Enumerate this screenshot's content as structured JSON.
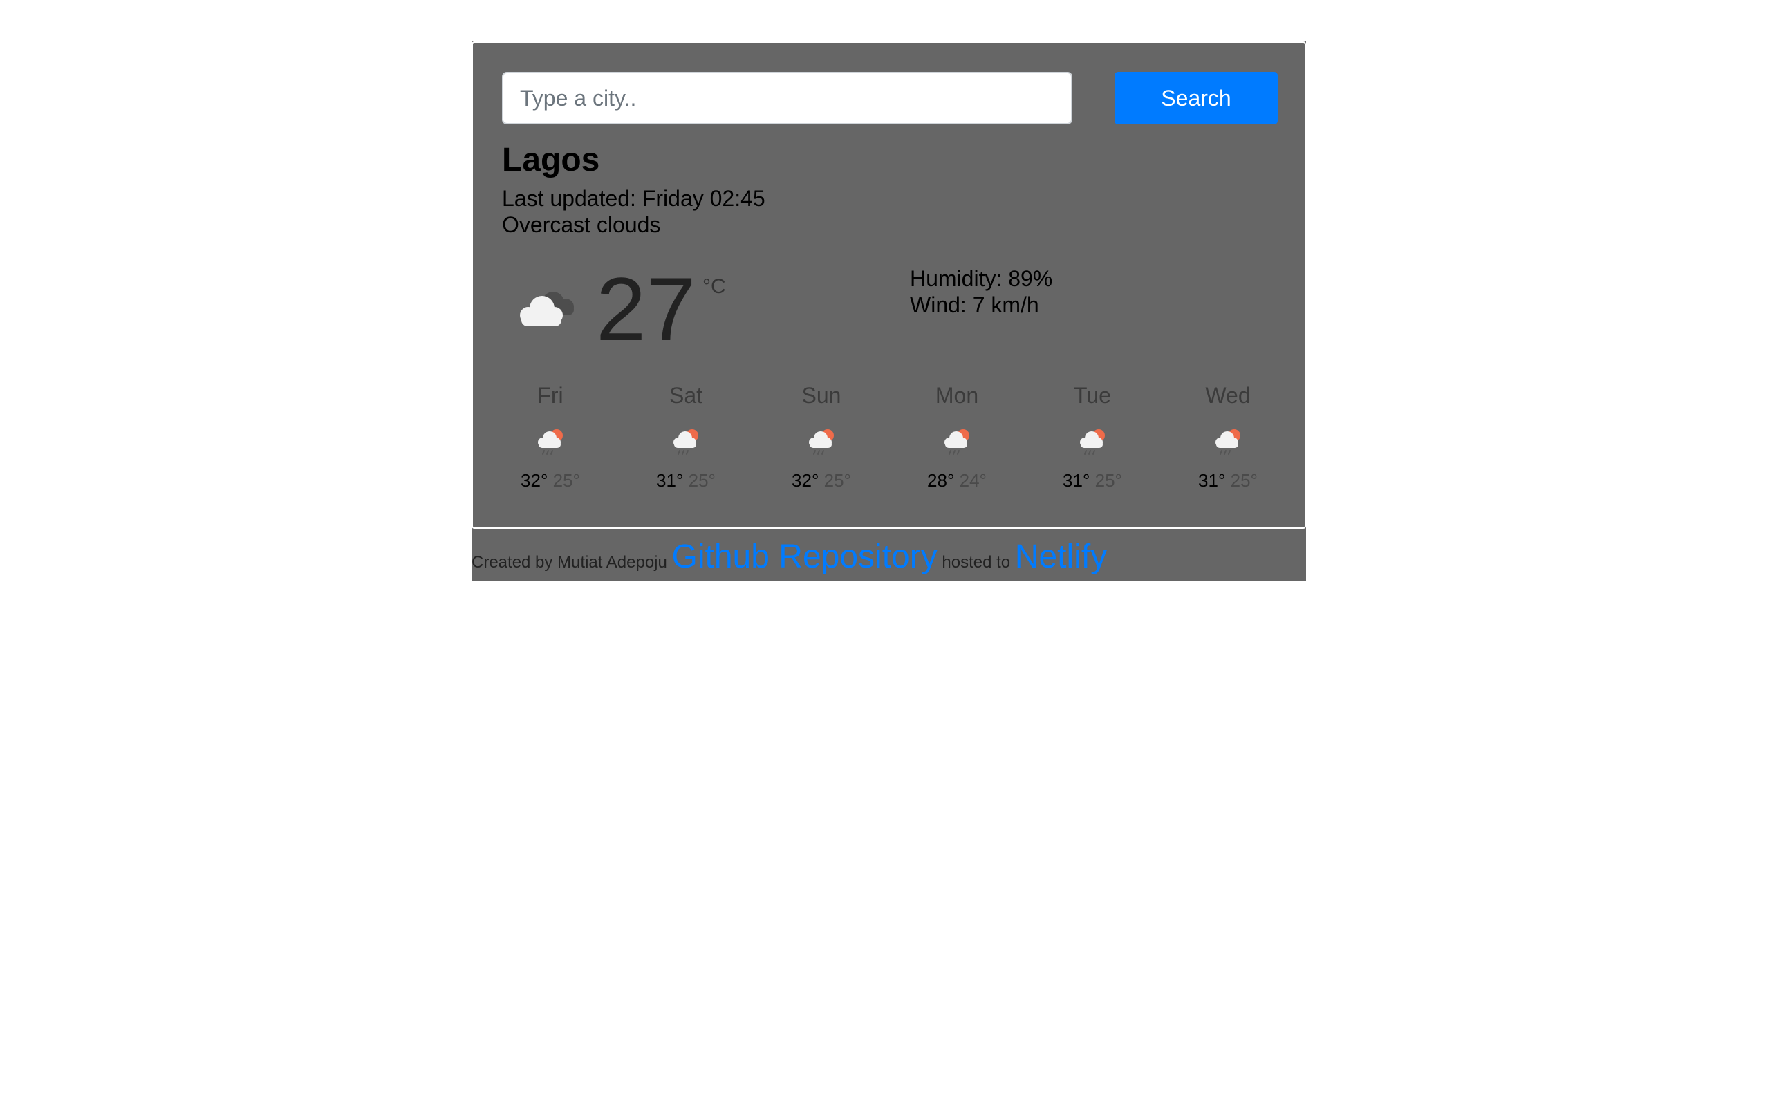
{
  "search": {
    "placeholder": "Type a city..",
    "value": "",
    "button_label": "Search"
  },
  "current": {
    "city": "Lagos",
    "last_updated": "Last updated: Friday 02:45",
    "description": "Overcast clouds",
    "temperature": "27",
    "unit": "°C",
    "humidity": "Humidity: 89%",
    "wind": "Wind: 7 km/h",
    "icon": "overcast-clouds-icon"
  },
  "forecast": [
    {
      "day": "Fri",
      "max": "32°",
      "min": "25°",
      "icon": "rain-sun-icon"
    },
    {
      "day": "Sat",
      "max": "31°",
      "min": "25°",
      "icon": "rain-sun-icon"
    },
    {
      "day": "Sun",
      "max": "32°",
      "min": "25°",
      "icon": "rain-sun-icon"
    },
    {
      "day": "Mon",
      "max": "28°",
      "min": "24°",
      "icon": "rain-sun-icon"
    },
    {
      "day": "Tue",
      "max": "31°",
      "min": "25°",
      "icon": "rain-sun-icon"
    },
    {
      "day": "Wed",
      "max": "31°",
      "min": "25°",
      "icon": "rain-sun-icon"
    }
  ],
  "footer": {
    "created_by": "Created by Mutiat Adepoju",
    "repo_link": "Github Repository",
    "hosted_to": "hosted to",
    "host_link": "Netlify"
  },
  "colors": {
    "card_bg": "#666666",
    "accent": "#007bff",
    "page_bg": "#ffffff"
  }
}
